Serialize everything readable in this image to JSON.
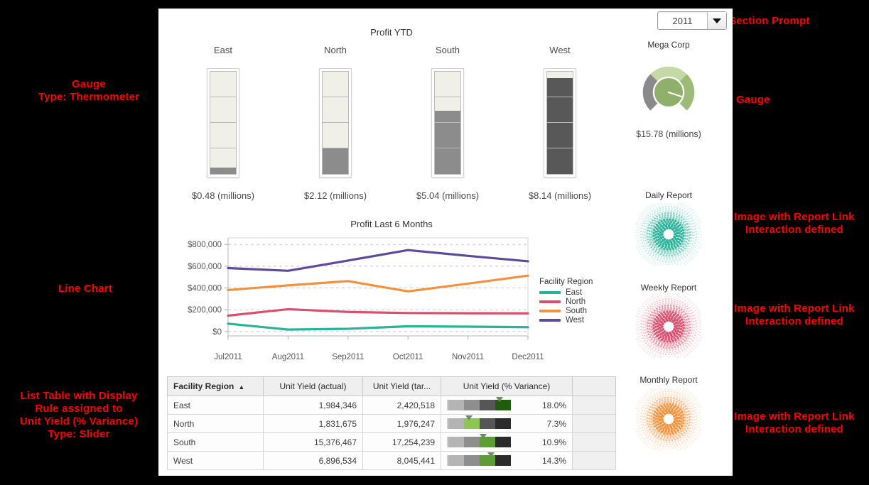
{
  "prompt": {
    "value": "2011",
    "icon": "chevron-down-icon"
  },
  "thermometer_panel": {
    "title": "Profit YTD",
    "items": [
      {
        "label": "East",
        "value_text": "$0.48 (millions)",
        "value": 0.48,
        "fill_pct": 6
      },
      {
        "label": "North",
        "value_text": "$2.12 (millions)",
        "value": 2.12,
        "fill_pct": 26
      },
      {
        "label": "South",
        "value_text": "$5.04 (millions)",
        "value": 5.04,
        "fill_pct": 62
      },
      {
        "label": "West",
        "value_text": "$8.14 (millions)",
        "value": 8.14,
        "fill_pct": 94
      }
    ],
    "band_count": 4,
    "fill_color": "#8c8c8c",
    "fill_color_dark": "#585858",
    "empty_color": "#f0f0e8"
  },
  "chart_data": {
    "type": "line",
    "title": "Profit Last 6 Months",
    "xlabel": "",
    "ylabel": "",
    "legend_title": "Facility Region",
    "legend_position": "right",
    "grid": true,
    "categories": [
      "Jul2011",
      "Aug2011",
      "Sep2011",
      "Oct2011",
      "Nov2011",
      "Dec2011"
    ],
    "ytick_labels": [
      "$0",
      "$200,000",
      "$400,000",
      "$600,000",
      "$800,000"
    ],
    "yticks": [
      0,
      200000,
      400000,
      600000,
      800000
    ],
    "ylim": [
      -40000,
      860000
    ],
    "series": [
      {
        "name": "East",
        "color": "#2bb29a",
        "values": [
          72000,
          18000,
          25000,
          48000,
          45000,
          40000
        ]
      },
      {
        "name": "North",
        "color": "#d94f6e",
        "values": [
          146000,
          205000,
          180000,
          170000,
          168000,
          167000
        ]
      },
      {
        "name": "South",
        "color": "#f29140",
        "values": [
          381000,
          424000,
          463000,
          369000,
          440000,
          513000
        ]
      },
      {
        "name": "West",
        "color": "#5e4a9c",
        "values": [
          583000,
          558000,
          652000,
          748000,
          695000,
          645000
        ]
      }
    ]
  },
  "table": {
    "columns": [
      "Facility Region",
      "Unit Yield (actual)",
      "Unit Yield (tar...",
      "Unit Yield (% Variance)",
      ""
    ],
    "sort_column": "Facility Region",
    "sort_indicator": "▲",
    "rows": [
      {
        "region": "East",
        "actual": "1,984,346",
        "target": "2,420,518",
        "variance": "18.0%",
        "marker_pct": 82,
        "active_band": 3
      },
      {
        "region": "North",
        "actual": "1,831,675",
        "target": "1,976,247",
        "variance": "7.3%",
        "marker_pct": 33,
        "active_band": 1
      },
      {
        "region": "South",
        "actual": "15,376,467",
        "target": "17,254,239",
        "variance": "10.9%",
        "marker_pct": 56,
        "active_band": 2
      },
      {
        "region": "West",
        "actual": "6,896,534",
        "target": "8,045,441",
        "variance": "14.3%",
        "marker_pct": 68,
        "active_band": 2
      }
    ],
    "slider_colors": [
      "#b4b4b4",
      "#8e8e8e",
      "#565656",
      "#2b2b2b"
    ],
    "slider_highlight": [
      "#9bcf6a",
      "#8dc653",
      "#5c9e33",
      "#1f5c0c"
    ]
  },
  "gauge_card": {
    "title": "Mega Corp",
    "value_text": "$15.78 (millions)",
    "fill_color": "#8fb06a",
    "light_color": "#c4d9a6",
    "empty_color": "#8a8a8a",
    "needle_pct": 62
  },
  "report_cards": [
    {
      "title": "Daily Report",
      "color": "#2bb29a",
      "icon": "radial-dots-icon"
    },
    {
      "title": "Weekly Report",
      "color": "#d94f6e",
      "icon": "radial-dots-icon"
    },
    {
      "title": "Monthly Report",
      "color": "#f2923c",
      "icon": "radial-dots-icon"
    }
  ],
  "annotations": {
    "left_gauge": "Gauge\nType: Thermometer",
    "left_line": "Line Chart",
    "left_table": "List Table with Display\nRule assigned to\nUnit Yield (% Variance)\nType: Slider",
    "right_prompt": "Section Prompt",
    "right_gauge": "Gauge",
    "right_report_1": "Image with Report Link\nInteraction defined",
    "right_report_2": "Image with Report Link\nInteraction defined",
    "right_report_3": "Image with Report Link\nInteraction defined"
  }
}
